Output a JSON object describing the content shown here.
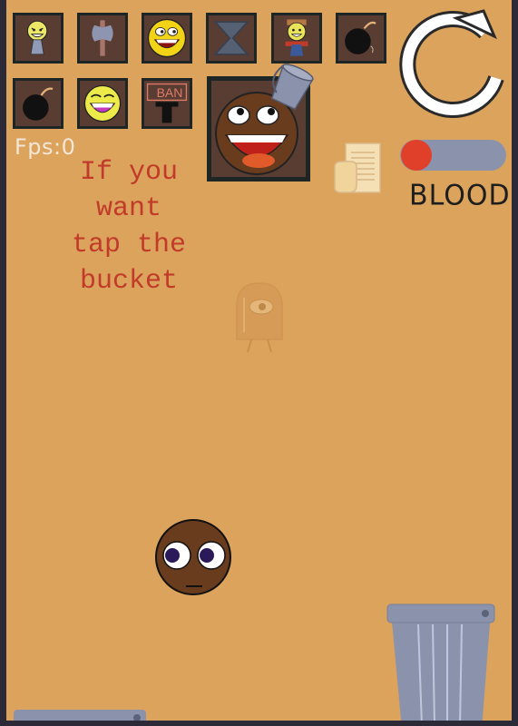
{
  "fps": "Fps:0",
  "hint": {
    "line1": "If you",
    "line2": "want",
    "line3": "tap the",
    "line4": "bucket"
  },
  "blood": {
    "label": "BLOOD",
    "enabled": false
  },
  "toolbar": {
    "items": [
      {
        "name": "smiley-doll",
        "icon": "smiley-doll-icon"
      },
      {
        "name": "axe",
        "icon": "axe-icon"
      },
      {
        "name": "laughing-face",
        "icon": "laughing-face-icon"
      },
      {
        "name": "hourglass",
        "icon": "hourglass-icon"
      },
      {
        "name": "gift-character",
        "icon": "gift-character-icon"
      },
      {
        "name": "bomb-dark",
        "icon": "bomb-icon"
      },
      {
        "name": "bomb",
        "icon": "bomb-icon"
      },
      {
        "name": "grinning-face",
        "icon": "grinning-face-icon"
      },
      {
        "name": "ban-hammer",
        "icon": "ban-hammer-icon",
        "text": "BAN"
      }
    ],
    "selected": {
      "name": "selected-face-with-bucket",
      "icon": "face-with-bucket-icon"
    }
  },
  "colors": {
    "background": "#dba35c",
    "frame": "#2c2a36",
    "slot": "#5a3d32",
    "slot_border": "#1d2624",
    "hint_text": "#c23a2a",
    "toggle_track": "#8b93ac",
    "toggle_knob": "#e0402a",
    "character_skin": "#6a3c1e"
  }
}
